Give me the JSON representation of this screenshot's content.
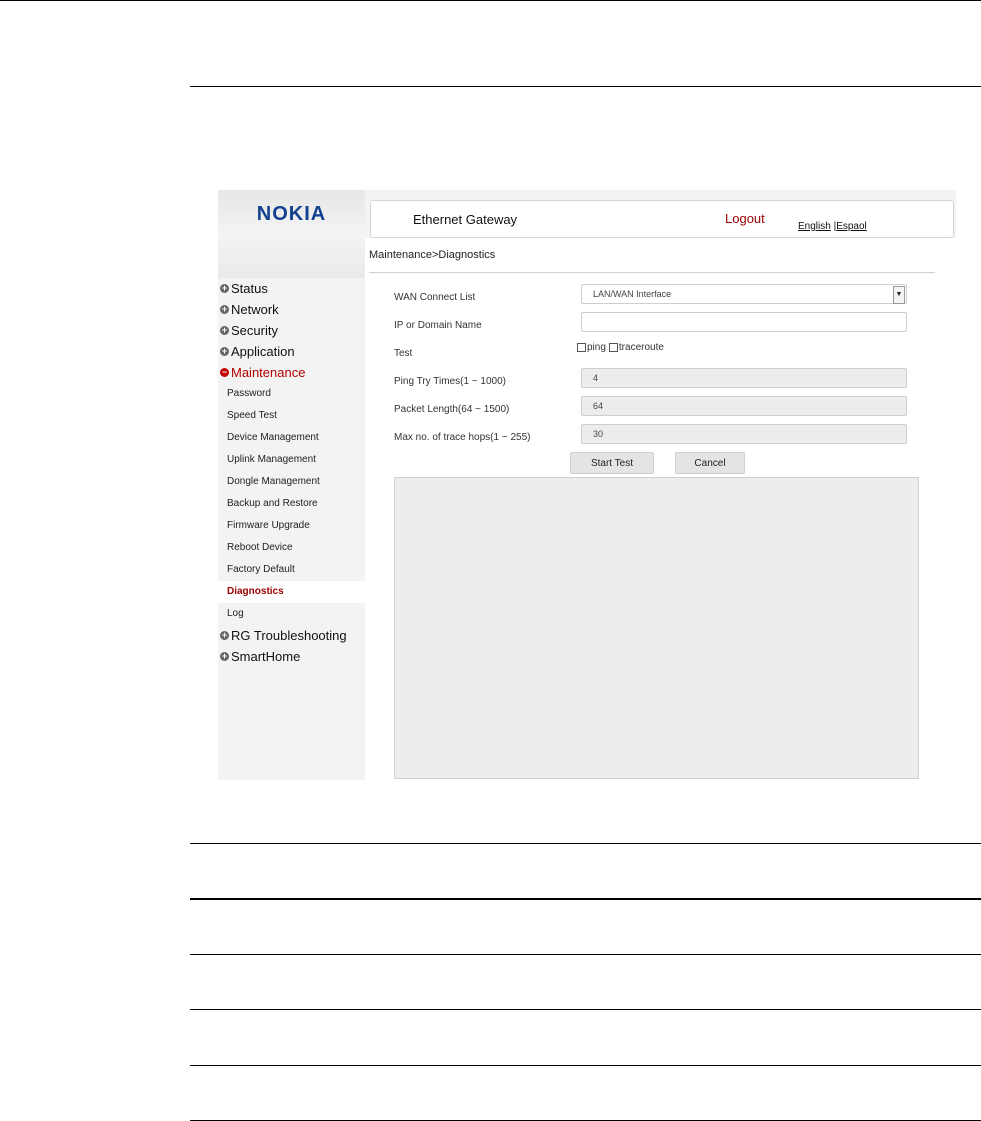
{
  "brand": {
    "logo": "NOKIA"
  },
  "header": {
    "title": "Ethernet Gateway",
    "logout": "Logout",
    "lang_english": "English",
    "lang_separator": "|",
    "lang_espanol": "Espaol"
  },
  "breadcrumb": "Maintenance>Diagnostics",
  "sidebar": {
    "categories_top": [
      "Status",
      "Network",
      "Security",
      "Application"
    ],
    "active_category": "Maintenance",
    "subitems": [
      "Password",
      "Speed Test",
      "Device Management",
      "Uplink Management",
      "Dongle Management",
      "Backup and Restore",
      "Firmware Upgrade",
      "Reboot Device",
      "Factory Default",
      "Diagnostics",
      "Log"
    ],
    "active_subitem": "Diagnostics",
    "categories_bottom": [
      "RG Troubleshooting",
      "SmartHome"
    ]
  },
  "form": {
    "wan_label": "WAN Connect List",
    "wan_value": "LAN/WAN Interface",
    "ip_label": "IP or Domain Name",
    "ip_value": "",
    "test_label": "Test",
    "ping_label": "ping",
    "traceroute_label": "traceroute",
    "ping_tries_label": "Ping Try Times(1 ~ 1000)",
    "ping_tries_value": "4",
    "packet_label": "Packet Length(64 ~ 1500)",
    "packet_value": "64",
    "hops_label": "Max no. of trace hops(1 ~ 255)",
    "hops_value": "30",
    "start_button": "Start Test",
    "cancel_button": "Cancel"
  },
  "colors": {
    "brand_blue": "#124191",
    "accent_red": "#9b0000"
  }
}
